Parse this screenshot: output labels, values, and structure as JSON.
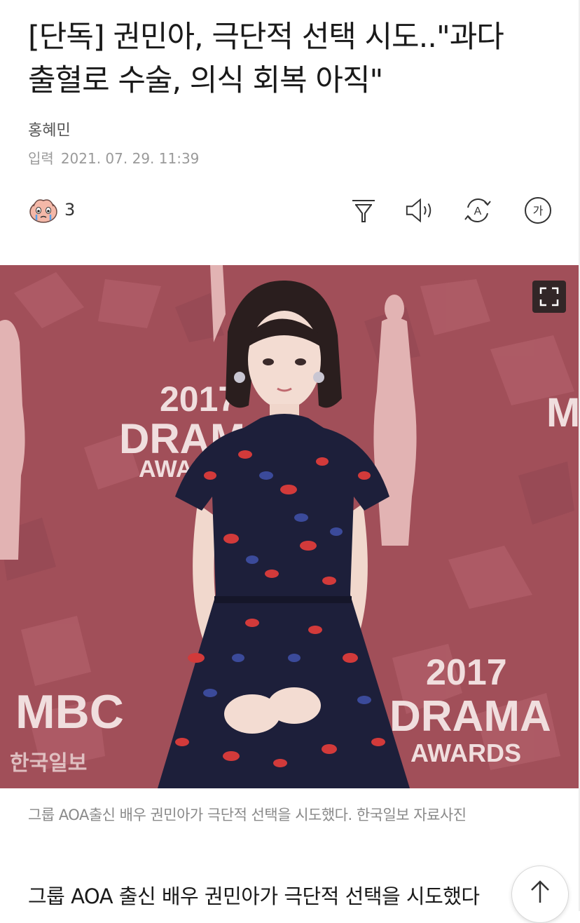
{
  "article": {
    "headline_line1": "[단독] 권민아, 극단적 선택 시도..\"과다",
    "headline_line2": "출혈로 수술, 의식 회복 아직\"",
    "author": "홍혜민",
    "date_label": "입력",
    "date_value": "2021. 07. 29. 11:39",
    "reaction_count": "3",
    "photo_caption": "그룹 AOA출신 배우 권민아가 극단적 선택을 시도했다. 한국일보 자료사진",
    "body_first_line": "그룹 AOA 출신 배우 권민아가 극단적 선택을 시도했다"
  },
  "photo": {
    "backdrop_texts": [
      "2017",
      "DRAMA",
      "AWARDS",
      "MBC",
      "2017",
      "DRAMA",
      "AWARDS",
      "MBC"
    ],
    "watermark": "한국일보"
  },
  "toolbar": {
    "icons": [
      "reaction-icon",
      "filter-icon",
      "speaker-icon",
      "translate-icon",
      "font-size-icon"
    ],
    "font_icon_text": "가",
    "translate_icon_text": "A"
  },
  "colors": {
    "backdrop": "#a14f59",
    "dress": "#1d1f3a",
    "petal_red": "#d23a3a",
    "caption": "#8a8a8a"
  }
}
